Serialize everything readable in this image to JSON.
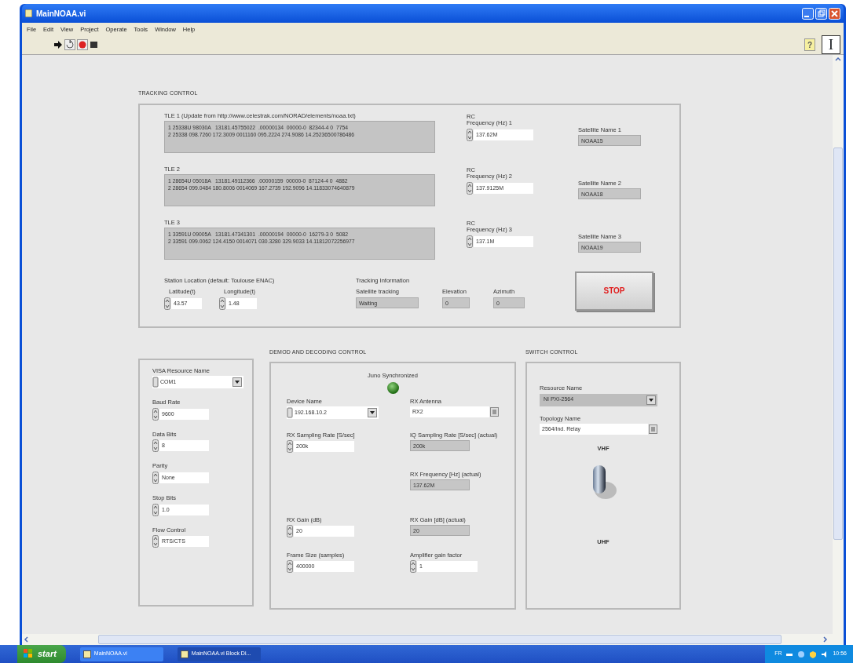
{
  "window": {
    "title": "MainNOAA.vi"
  },
  "menu": [
    "File",
    "Edit",
    "View",
    "Project",
    "Operate",
    "Tools",
    "Window",
    "Help"
  ],
  "toolbar": {
    "context_help": "?",
    "vi_icon": "I"
  },
  "tracking": {
    "title": "TRACKING CONTROL",
    "tles": [
      {
        "label": "TLE 1 (Update from http://www.celestrak.com/NORAD/elements/noaa.txt)",
        "lines": [
          "1 25338U 98030A   13181.45755022  .00000134  00000-0  82344-4 0  7754",
          "2 25338 098.7260 172.3009 0011160 095.2224 274.9086 14.25236500786486"
        ]
      },
      {
        "label": "TLE 2",
        "lines": [
          "1 28654U 05018A   13181.49112366  .00000159  00000-0  87124-4 0  4882",
          "2 28654 099.0484 180.8006 0014069 167.2739 192.9096 14.11833074640879"
        ]
      },
      {
        "label": "TLE 3",
        "lines": [
          "1 33591U 09005A   13181.47341301  .00000194  00000-0  16279-3 0  5082",
          "2 33591 099.0062 124.4150 0014071 030.3280 329.9033 14.11812072256977"
        ]
      }
    ],
    "frequencies": [
      {
        "label": "RC\nFrequency (Hz) 1",
        "value": "137.62M"
      },
      {
        "label": "RC\nFrequency (Hz) 2",
        "value": "137.9125M"
      },
      {
        "label": "RC\nFrequency (Hz) 3",
        "value": "137.1M"
      }
    ],
    "satellites": [
      {
        "label": "Satellite Name 1",
        "value": "NOAA15"
      },
      {
        "label": "Satellite Name 2",
        "value": "NOAA18"
      },
      {
        "label": "Satellite Name 3",
        "value": "NOAA19"
      }
    ],
    "station": {
      "title": "Station Location (default: Toulouse ENAC)",
      "fields": [
        {
          "label": "Latitude(t)",
          "value": "43.57"
        },
        {
          "label": "Longitude(t)",
          "value": "1.48"
        }
      ]
    },
    "tracking_info": {
      "title": "Tracking Information",
      "fields": [
        {
          "label": "Satellite tracking",
          "value": "Waiting"
        },
        {
          "label": "Elevation",
          "value": "0"
        },
        {
          "label": "Azimuth",
          "value": "0"
        }
      ]
    },
    "stop_button": "STOP"
  },
  "serial": {
    "fields": [
      {
        "kind": "dropdown",
        "label": "VISA Resource Name",
        "value": "COM1"
      },
      {
        "kind": "numeric",
        "label": "Baud Rate",
        "value": "9600"
      },
      {
        "kind": "numeric",
        "label": "Data Bits",
        "value": "8"
      },
      {
        "kind": "numeric",
        "label": "Parity",
        "value": "None"
      },
      {
        "kind": "numeric",
        "label": "Stop Bits",
        "value": "1.0"
      },
      {
        "kind": "numeric",
        "label": "Flow Control",
        "value": "RTS/CTS"
      }
    ]
  },
  "demod": {
    "title": "DEMOD AND DECODING CONTROL",
    "led": {
      "label": "Juno Synchronized",
      "on": true
    },
    "left": [
      {
        "kind": "dropdown",
        "label": "Device Name",
        "value": "192.168.10.2"
      },
      {
        "kind": "numeric",
        "label": "RX Sampling Rate [S/sec]",
        "value": "200k"
      },
      {
        "kind": "numeric",
        "label": "RX Gain (dB)",
        "value": "20"
      },
      {
        "kind": "numeric",
        "label": "Frame Size (samples)",
        "value": "400000"
      }
    ],
    "right": [
      {
        "kind": "browse",
        "label": "RX Antenna",
        "value": "RX2"
      },
      {
        "kind": "indicator",
        "label": "IQ Sampling Rate [S/sec] (actual)",
        "value": "200k"
      },
      {
        "kind": "indicator",
        "label": "RX Frequency [Hz] (actual)",
        "value": "137.62M"
      },
      {
        "kind": "indicator",
        "label": "RX Gain [dB] (actual)",
        "value": "20"
      },
      {
        "kind": "numeric",
        "label": "Amplifier gain factor",
        "value": "1"
      }
    ]
  },
  "switch_control": {
    "title": "SWITCH CONTROL",
    "fields": [
      {
        "kind": "grey_dropdown",
        "label": "Resource Name",
        "value": "NI PXI-2564"
      },
      {
        "kind": "browse",
        "label": "Topology Name",
        "value": "2564/Ind. Relay"
      }
    ],
    "toggle": {
      "top_label": "VHF",
      "bottom_label": "UHF",
      "up": true
    }
  },
  "taskbar": {
    "start": "start",
    "items": [
      {
        "label": "MainNOAA.vi",
        "selected": false
      },
      {
        "label": "MainNOAA.vi Block Di...",
        "selected": true
      }
    ],
    "language": "FR",
    "clock": "10:56"
  }
}
